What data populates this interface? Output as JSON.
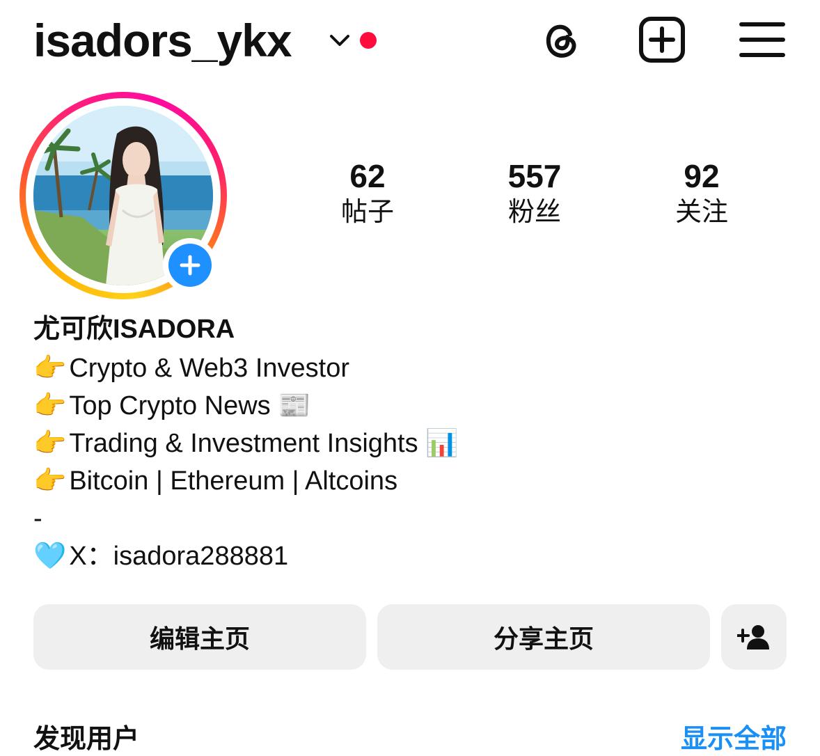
{
  "header": {
    "username": "isadors_ykx",
    "icons": [
      "chevron-down-icon",
      "notification-dot",
      "threads-icon",
      "create-plus-icon",
      "menu-icon"
    ]
  },
  "colors": {
    "notification_dot": "#ff0c3d",
    "add_story_badge": "#1e90ff",
    "link_blue": "#1a8ff5",
    "button_bg": "#efefef"
  },
  "stats": {
    "posts": {
      "value": "62",
      "label": "帖子"
    },
    "followers": {
      "value": "557",
      "label": "粉丝"
    },
    "following": {
      "value": "92",
      "label": "关注"
    }
  },
  "bio": {
    "display_name": "尤可欣ISADORA",
    "lines": [
      {
        "emoji": "👉",
        "text": "Crypto & Web3 Investor",
        "trail": ""
      },
      {
        "emoji": "👉",
        "text": "Top Crypto News ",
        "trail": "📰"
      },
      {
        "emoji": "👉",
        "text": "Trading & Investment Insights ",
        "trail": "📊"
      },
      {
        "emoji": "👉",
        "text": "Bitcoin | Ethereum | Altcoins",
        "trail": ""
      },
      {
        "emoji": "",
        "text": "-",
        "trail": ""
      },
      {
        "emoji": "🩵",
        "text": "X：isadora288881",
        "trail": ""
      }
    ]
  },
  "buttons": {
    "edit_profile": "编辑主页",
    "share_profile": "分享主页",
    "discover_people_icon": "add-person-icon"
  },
  "discover": {
    "title": "发现用户",
    "show_all": "显示全部"
  }
}
